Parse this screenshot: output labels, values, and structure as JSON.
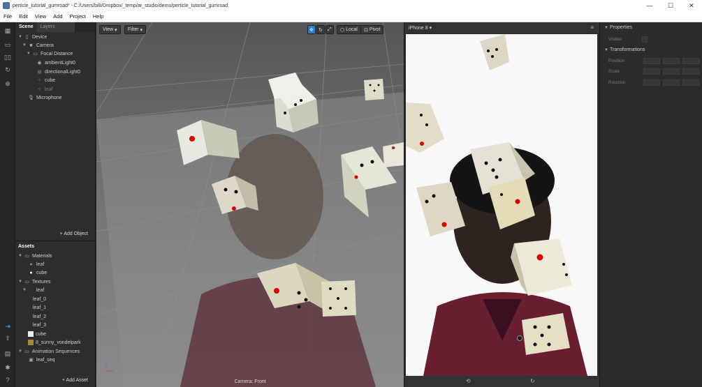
{
  "window": {
    "title": "perticle_tutorial_gumroad* - C:/Users/billi/Dropbox/_temp/ar_studio/demo/perticle_tutorial_gumroad",
    "minimize": "—",
    "maximize": "☐",
    "close": "✕"
  },
  "menu": [
    "File",
    "Edit",
    "View",
    "Add",
    "Project",
    "Help"
  ],
  "scene": {
    "tab_scene": "Scene",
    "tab_layers": "Layers",
    "items": [
      {
        "label": "Device"
      },
      {
        "label": "Camera"
      },
      {
        "label": "Focal Distance"
      },
      {
        "label": "ambientLight0"
      },
      {
        "label": "directionalLight0"
      },
      {
        "label": "cube"
      },
      {
        "label": "leaf"
      },
      {
        "label": "Microphone"
      }
    ],
    "add_object": "Add Object"
  },
  "assets": {
    "title": "Assets",
    "items": [
      {
        "label": "Materials"
      },
      {
        "label": "leaf"
      },
      {
        "label": "cube"
      },
      {
        "label": "Textures"
      },
      {
        "label": "leaf"
      },
      {
        "label": "leaf_0"
      },
      {
        "label": "leaf_1"
      },
      {
        "label": "leaf_2"
      },
      {
        "label": "leaf_3"
      },
      {
        "label": "cube"
      },
      {
        "label": "8_sunny_vondelpark"
      },
      {
        "label": "Animation Sequences"
      },
      {
        "label": "leaf_seq"
      }
    ],
    "add_asset": "Add Asset"
  },
  "viewport": {
    "view_btn": "View",
    "filter_btn": "Filter",
    "local_btn": "Local",
    "pivot_btn": "Pivot",
    "camera_label": "Camera: Front"
  },
  "simulator": {
    "device": "iPhone 8"
  },
  "properties": {
    "title": "Properties",
    "visible": "Visible",
    "transformations": "Transformations",
    "position": "Position",
    "scale": "Scale",
    "rotation": "Rotation"
  }
}
